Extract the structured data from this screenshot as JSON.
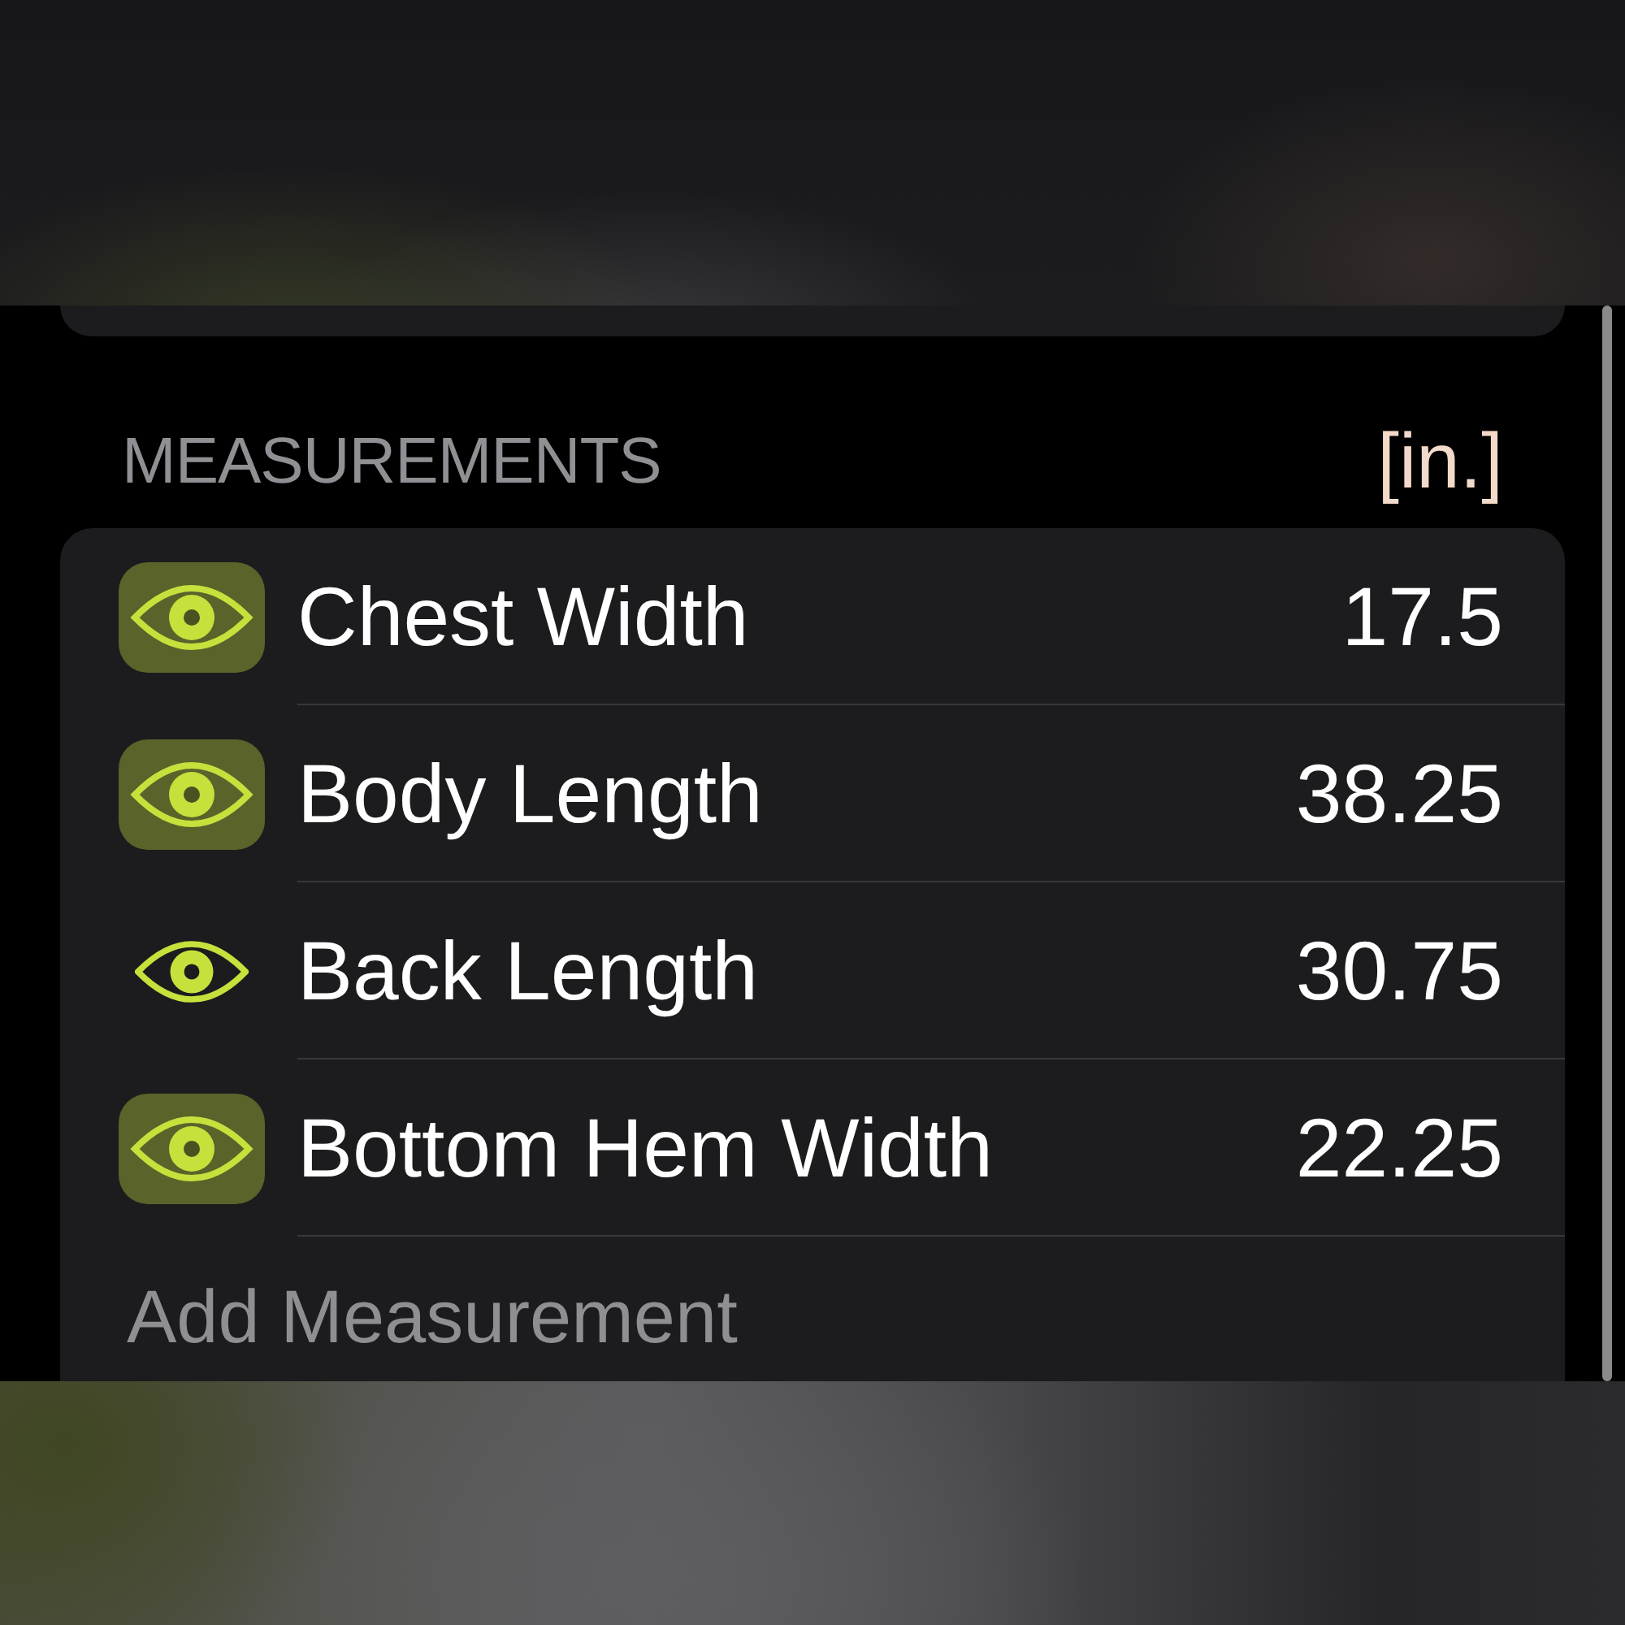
{
  "section": {
    "title": "MEASUREMENTS",
    "unit": "[in.]"
  },
  "measurements": [
    {
      "name": "Chest Width",
      "value": "17.5",
      "highlighted": true
    },
    {
      "name": "Body Length",
      "value": "38.25",
      "highlighted": true
    },
    {
      "name": "Back Length",
      "value": "30.75",
      "highlighted": false
    },
    {
      "name": "Bottom Hem Width",
      "value": "22.25",
      "highlighted": true
    }
  ],
  "add_button": {
    "label": "Add Measurement"
  }
}
